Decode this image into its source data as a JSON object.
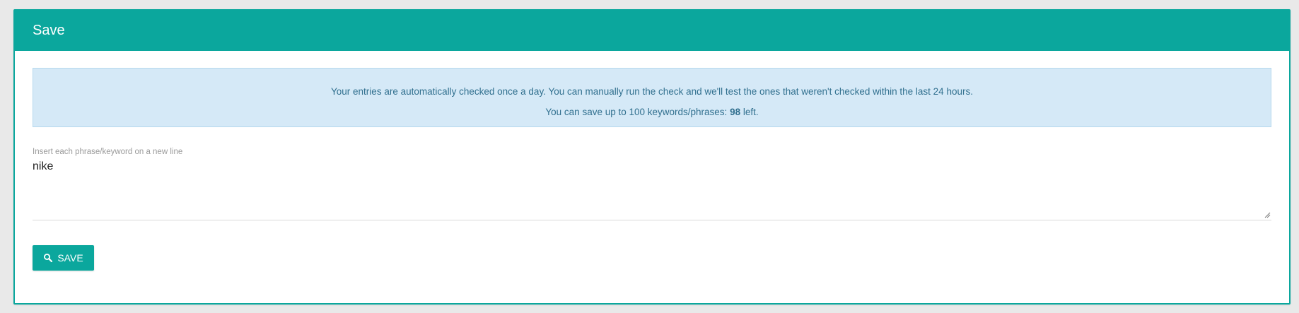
{
  "panel": {
    "title": "Save"
  },
  "info": {
    "line1": "Your entries are automatically checked once a day. You can manually run the check and we'll test the ones that weren't checked within the last 24 hours.",
    "line2_prefix": "You can save up to 100 keywords/phrases: ",
    "line2_count": "98",
    "line2_suffix": " left."
  },
  "keywords_field": {
    "label": "Insert each phrase/keyword on a new line",
    "value": "nike"
  },
  "save_button": {
    "label": "SAVE",
    "icon": "search-icon"
  },
  "colors": {
    "accent": "#0ba79d",
    "info_bg": "#d5e9f7",
    "info_text": "#31708f"
  }
}
